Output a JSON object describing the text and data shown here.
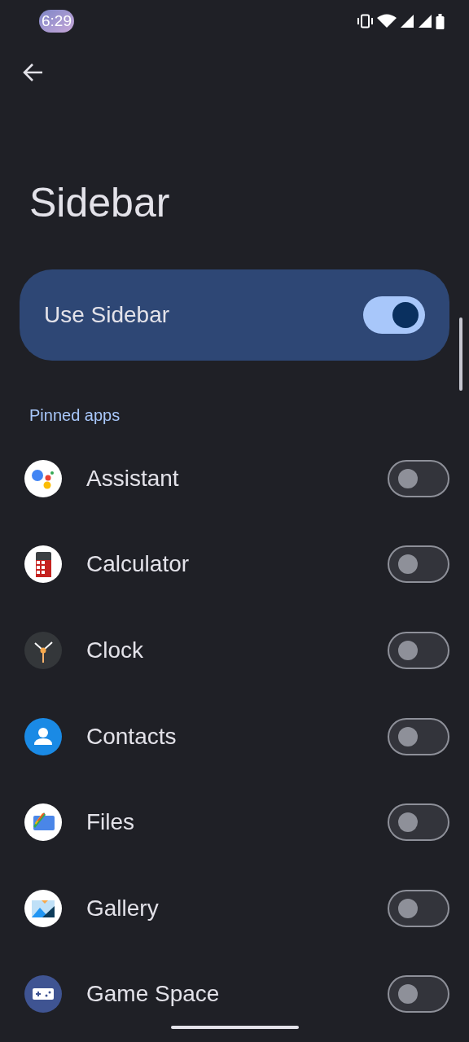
{
  "status_bar": {
    "time": "6:29"
  },
  "title": "Sidebar",
  "main_switch": {
    "label": "Use Sidebar",
    "on": true
  },
  "section_label": "Pinned apps",
  "apps": [
    {
      "kind": "assistant",
      "name": "Assistant",
      "on": false
    },
    {
      "kind": "calculator",
      "name": "Calculator",
      "on": false
    },
    {
      "kind": "clock",
      "name": "Clock",
      "on": false
    },
    {
      "kind": "contacts",
      "name": "Contacts",
      "on": false
    },
    {
      "kind": "files",
      "name": "Files",
      "on": false
    },
    {
      "kind": "gallery",
      "name": "Gallery",
      "on": false
    },
    {
      "kind": "game",
      "name": "Game Space",
      "on": false
    }
  ]
}
